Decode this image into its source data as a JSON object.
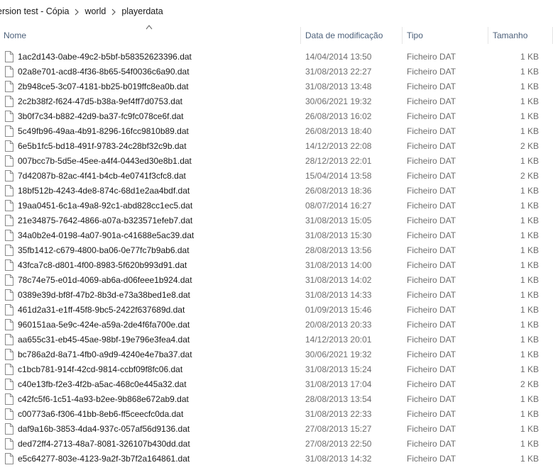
{
  "breadcrumb": {
    "items": [
      "ersion test - Cópia",
      "world",
      "playerdata"
    ]
  },
  "columns": {
    "name": "Nome",
    "date": "Data de modificação",
    "type": "Tipo",
    "size": "Tamanho"
  },
  "files": [
    {
      "name": "1ac2d143-0abe-49c2-b5bf-b58352623396.dat",
      "date": "14/04/2014 13:50",
      "type": "Ficheiro DAT",
      "size": "1 KB"
    },
    {
      "name": "02a8e701-acd8-4f36-8b65-54f0036c6a90.dat",
      "date": "31/08/2013 22:27",
      "type": "Ficheiro DAT",
      "size": "1 KB"
    },
    {
      "name": "2b948ce5-3c07-4181-bb25-b019ffc8ea0b.dat",
      "date": "31/08/2013 13:48",
      "type": "Ficheiro DAT",
      "size": "1 KB"
    },
    {
      "name": "2c2b38f2-f624-47d5-b38a-9ef4ff7d0753.dat",
      "date": "30/06/2021 19:32",
      "type": "Ficheiro DAT",
      "size": "1 KB"
    },
    {
      "name": "3b0f7c34-b882-42d9-ba37-fc9fc078ce6f.dat",
      "date": "26/08/2013 16:02",
      "type": "Ficheiro DAT",
      "size": "1 KB"
    },
    {
      "name": "5c49fb96-49aa-4b91-8296-16fcc9810b89.dat",
      "date": "26/08/2013 18:40",
      "type": "Ficheiro DAT",
      "size": "1 KB"
    },
    {
      "name": "6e5b1fc5-bd18-491f-9783-24c28bf32c9b.dat",
      "date": "14/12/2013 22:08",
      "type": "Ficheiro DAT",
      "size": "2 KB"
    },
    {
      "name": "007bcc7b-5d5e-45ee-a4f4-0443ed30e8b1.dat",
      "date": "28/12/2013 22:01",
      "type": "Ficheiro DAT",
      "size": "1 KB"
    },
    {
      "name": "7d42087b-82ac-4f41-b4cb-4e0741f3cfc8.dat",
      "date": "15/04/2014 13:58",
      "type": "Ficheiro DAT",
      "size": "2 KB"
    },
    {
      "name": "18bf512b-4243-4de8-874c-68d1e2aa4bdf.dat",
      "date": "26/08/2013 18:36",
      "type": "Ficheiro DAT",
      "size": "1 KB"
    },
    {
      "name": "19aa0451-6c1a-49a8-92c1-abd828cc1ec5.dat",
      "date": "08/07/2014 16:27",
      "type": "Ficheiro DAT",
      "size": "1 KB"
    },
    {
      "name": "21e34875-7642-4866-a07a-b323571efeb7.dat",
      "date": "31/08/2013 15:05",
      "type": "Ficheiro DAT",
      "size": "1 KB"
    },
    {
      "name": "34a0b2e4-0198-4a07-901a-c41688e5ac39.dat",
      "date": "31/08/2013 15:30",
      "type": "Ficheiro DAT",
      "size": "1 KB"
    },
    {
      "name": "35fb1412-c679-4800-ba06-0e77fc7b9ab6.dat",
      "date": "28/08/2013 13:56",
      "type": "Ficheiro DAT",
      "size": "1 KB"
    },
    {
      "name": "43fca7c8-d801-4f00-8983-5f620b993d91.dat",
      "date": "31/08/2013 14:00",
      "type": "Ficheiro DAT",
      "size": "1 KB"
    },
    {
      "name": "78c74e75-e01d-4069-ab6a-d06feee1b924.dat",
      "date": "31/08/2013 14:02",
      "type": "Ficheiro DAT",
      "size": "1 KB"
    },
    {
      "name": "0389e39d-bf8f-47b2-8b3d-e73a38bed1e8.dat",
      "date": "31/08/2013 14:33",
      "type": "Ficheiro DAT",
      "size": "1 KB"
    },
    {
      "name": "461d2a31-e1ff-45f8-9bc5-2422f637689d.dat",
      "date": "01/09/2013 15:46",
      "type": "Ficheiro DAT",
      "size": "1 KB"
    },
    {
      "name": "960151aa-5e9c-424e-a59a-2de4f6fa700e.dat",
      "date": "20/08/2013 20:33",
      "type": "Ficheiro DAT",
      "size": "1 KB"
    },
    {
      "name": "aa655c31-eb45-45ae-98bf-19e796e3fea4.dat",
      "date": "14/12/2013 20:01",
      "type": "Ficheiro DAT",
      "size": "1 KB"
    },
    {
      "name": "bc786a2d-8a71-4fb0-a9d9-4240e4e7ba37.dat",
      "date": "30/06/2021 19:32",
      "type": "Ficheiro DAT",
      "size": "1 KB"
    },
    {
      "name": "c1bcb781-914f-42cd-9814-ccbf09f8fc06.dat",
      "date": "31/08/2013 15:24",
      "type": "Ficheiro DAT",
      "size": "1 KB"
    },
    {
      "name": "c40e13fb-f2e3-4f2b-a5ac-468c0e445a32.dat",
      "date": "31/08/2013 17:04",
      "type": "Ficheiro DAT",
      "size": "2 KB"
    },
    {
      "name": "c42fc5f6-1c51-4a93-b2ee-9b868e672ab9.dat",
      "date": "28/08/2013 13:54",
      "type": "Ficheiro DAT",
      "size": "1 KB"
    },
    {
      "name": "c00773a6-f306-41bb-8eb6-ff5ceecfc0da.dat",
      "date": "31/08/2013 22:33",
      "type": "Ficheiro DAT",
      "size": "1 KB"
    },
    {
      "name": "daf9a16b-3853-4da4-937c-057af56d9136.dat",
      "date": "27/08/2013 15:27",
      "type": "Ficheiro DAT",
      "size": "1 KB"
    },
    {
      "name": "ded72ff4-2713-48a7-8081-326107b430dd.dat",
      "date": "27/08/2013 22:50",
      "type": "Ficheiro DAT",
      "size": "1 KB"
    },
    {
      "name": "e5c64277-803e-4123-9a2f-3b7f2a164861.dat",
      "date": "31/08/2013 14:32",
      "type": "Ficheiro DAT",
      "size": "1 KB"
    }
  ]
}
